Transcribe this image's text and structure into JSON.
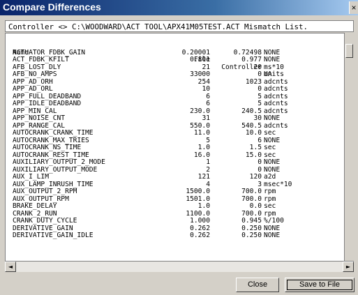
{
  "window": {
    "title": "Compare Differences",
    "close_glyph": "×"
  },
  "header_line": "Controller <> C:\\WOODWARD\\ACT TOOL\\APX41M05TEST.ACT Mismatch List.",
  "columns": {
    "name": "Name",
    "file": "File",
    "controller": "Controller",
    "units": "Units"
  },
  "rows": [
    [
      "ACTUATOR_FDBK_GAIN",
      "0.20001",
      "0.72498",
      "NONE"
    ],
    [
      "ACT_FDBK_KFILT",
      "0.801",
      "0.977",
      "NONE"
    ],
    [
      "AFB_LOST_DLY",
      "21",
      "20",
      "ms*10"
    ],
    [
      "AFB_NO_AMPS",
      "33000",
      "0",
      "mA"
    ],
    [
      "APP_AD_ORH",
      "254",
      "1023",
      "adcnts"
    ],
    [
      "APP_AD_ORL",
      "10",
      "0",
      "adcnts"
    ],
    [
      "APP_FULL_DEADBAND",
      "6",
      "5",
      "adcnts"
    ],
    [
      "APP_IDLE_DEADBAND",
      "6",
      "5",
      "adcnts"
    ],
    [
      "APP_MIN_CAL",
      "230.0",
      "240.5",
      "adcnts"
    ],
    [
      "APP_NOISE_CNT",
      "31",
      "30",
      "NONE"
    ],
    [
      "APP_RANGE_CAL",
      "550.0",
      "540.5",
      "adcnts"
    ],
    [
      "AUTOCRANK_CRANK_TIME",
      "11.0",
      "10.0",
      "sec"
    ],
    [
      "AUTOCRANK_MAX_TRIES",
      "5",
      "6",
      "NONE"
    ],
    [
      "AUTOCRANK_NS_TIME",
      "1.0",
      "1.5",
      "sec"
    ],
    [
      "AUTOCRANK_REST_TIME",
      "16.0",
      "15.0",
      "sec"
    ],
    [
      "AUXILIARY_OUTPUT_2_MODE",
      "1",
      "0",
      "NONE"
    ],
    [
      "AUXILIARY_OUTPUT_MODE",
      "2",
      "0",
      "NONE"
    ],
    [
      "AUX_I_LIM",
      "121",
      "120",
      "a2d"
    ],
    [
      "AUX_LAMP_INRUSH_TIME",
      "4",
      "3",
      "msec*10"
    ],
    [
      "AUX_OUTPUT_2_RPM",
      "1500.0",
      "700.0",
      "rpm"
    ],
    [
      "AUX_OUTPUT_RPM",
      "1501.0",
      "700.0",
      "rpm"
    ],
    [
      "BRAKE_DELAY",
      "1.0",
      "0.0",
      "sec"
    ],
    [
      "CRANK_2_RUN",
      "1100.0",
      "700.0",
      "rpm"
    ],
    [
      "CRANK_DUTY_CYCLE",
      "1.000",
      "0.945",
      "%/100"
    ],
    [
      "DERIVATIVE_GAIN",
      "0.262",
      "0.250",
      "NONE"
    ],
    [
      "DERIVATIVE_GAIN_IDLE",
      "0.262",
      "0.250",
      "NONE"
    ]
  ],
  "buttons": {
    "close": "Close",
    "save": "Save to File"
  },
  "scroll": {
    "left_arrow": "◄",
    "right_arrow": "►"
  }
}
